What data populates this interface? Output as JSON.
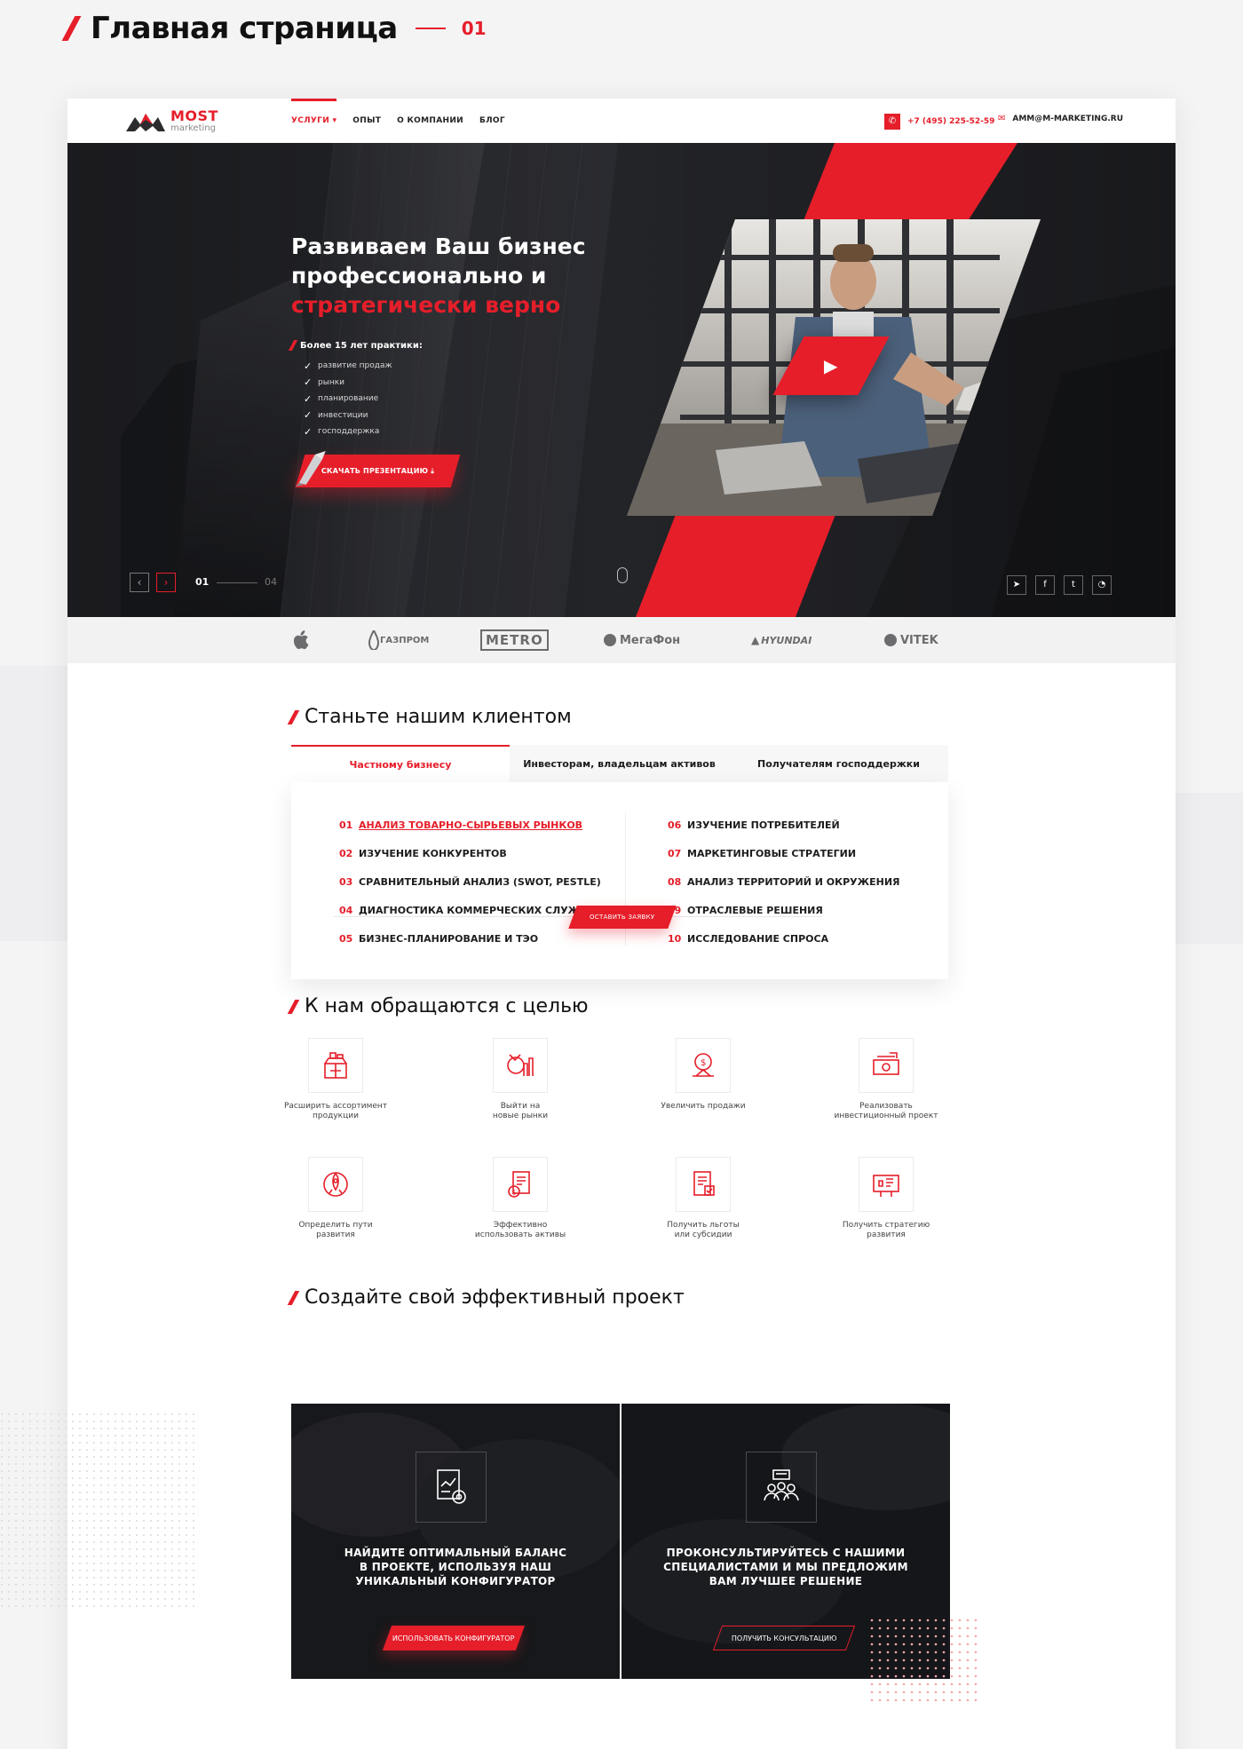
{
  "page": {
    "title": "Главная страница",
    "number": "01"
  },
  "header": {
    "logo": {
      "brand": "MOST",
      "sub": "marketing"
    },
    "nav": [
      {
        "label": "УСЛУГИ ▾",
        "active": true
      },
      {
        "label": "ОПЫТ"
      },
      {
        "label": "О КОМПАНИИ"
      },
      {
        "label": "БЛОГ"
      }
    ],
    "phone": "+7 (495) 225-52-59",
    "email": "AMM@M-MARKETING.RU"
  },
  "hero": {
    "title_line1": "Развиваем Ваш бизнес",
    "title_line2": "профессионально и",
    "title_line3": "стратегически верно",
    "experience": "Более 15 лет практики:",
    "checklist": [
      "развитие продаж",
      "рынки",
      "планирование",
      "инвестиции",
      "господдержка"
    ],
    "download_label": "СКАЧАТЬ ПРЕЗЕНТАЦИЮ ⤓",
    "slide_current": "01",
    "slide_total": "04",
    "social": [
      "telegram-icon",
      "facebook-icon",
      "twitter-icon",
      "whatsapp-icon"
    ]
  },
  "brands": [
    "",
    "ГАЗПРОМ",
    "METRO",
    "МегаФон",
    "HYUNDAI",
    "VITEK"
  ],
  "clients": {
    "title": "Станьте нашим клиентом",
    "tabs": [
      {
        "label": "Частному бизнесу",
        "active": true
      },
      {
        "label": "Инвесторам, владельцам активов"
      },
      {
        "label": "Получателям господдержки"
      }
    ],
    "left": [
      {
        "n": "01",
        "t": "АНАЛИЗ ТОВАРНО-СЫРЬЕВЫХ РЫНКОВ"
      },
      {
        "n": "02",
        "t": "ИЗУЧЕНИЕ КОНКУРЕНТОВ"
      },
      {
        "n": "03",
        "t": "СРАВНИТЕЛЬНЫЙ АНАЛИЗ (SWOT, PESTLE)"
      },
      {
        "n": "04",
        "t": "ДИАГНОСТИКА КОММЕРЧЕСКИХ СЛУЖБ"
      },
      {
        "n": "05",
        "t": "БИЗНЕС-ПЛАНИРОВАНИЕ И ТЭО"
      }
    ],
    "right": [
      {
        "n": "06",
        "t": "ИЗУЧЕНИЕ ПОТРЕБИТЕЛЕЙ"
      },
      {
        "n": "07",
        "t": "МАРКЕТИНГОВЫЕ СТРАТЕГИИ"
      },
      {
        "n": "08",
        "t": "АНАЛИЗ ТЕРРИТОРИЙ И ОКРУЖЕНИЯ"
      },
      {
        "n": "09",
        "t": "ОТРАСЛЕВЫЕ РЕШЕНИЯ"
      },
      {
        "n": "10",
        "t": "ИССЛЕДОВАНИЕ СПРОСА"
      }
    ],
    "request_label": "ОСТАВИТЬ ЗАЯВКУ"
  },
  "goals": {
    "title": "К нам обращаются с целью",
    "items": [
      {
        "l1": "Расширить ассортимент",
        "l2": "продукции",
        "icon": "boxes-icon"
      },
      {
        "l1": "Выйти на",
        "l2": "новые рынки",
        "icon": "market-growth-icon"
      },
      {
        "l1": "Увеличить продажи",
        "l2": "",
        "icon": "money-target-icon"
      },
      {
        "l1": "Реализовать",
        "l2": "инвестиционный проект",
        "icon": "banknote-icon"
      },
      {
        "l1": "Определить пути",
        "l2": "развития",
        "icon": "rocket-icon"
      },
      {
        "l1": "Эффективно",
        "l2": "использовать активы",
        "icon": "assets-document-icon"
      },
      {
        "l1": "Получить льготы",
        "l2": "или субсидии",
        "icon": "subsidy-document-icon"
      },
      {
        "l1": "Получить стратегию",
        "l2": "развития",
        "icon": "strategy-board-icon"
      }
    ]
  },
  "project": {
    "title": "Создайте свой эффективный проект",
    "cards": [
      {
        "l1": "НАЙДИТЕ ОПТИМАЛЬНЫЙ БАЛАНС",
        "l2": "В ПРОЕКТЕ, ИСПОЛЬЗУЯ НАШ",
        "l3": "УНИКАЛЬНЫЙ КОНФИГУРАТОР",
        "button": "ИСПОЛЬЗОВАТЬ КОНФИГУРАТОР"
      },
      {
        "l1": "ПРОКОНСУЛЬТИРУЙТЕСЬ С НАШИМИ",
        "l2": "СПЕЦИАЛИСТАМИ И МЫ ПРЕДЛОЖИМ",
        "l3": "ВАМ ЛУЧШЕЕ РЕШЕНИЕ",
        "button": "ПОЛУЧИТЬ КОНСУЛЬТАЦИЮ"
      }
    ]
  },
  "colors": {
    "accent": "#e61e2a",
    "dark": "#2a2b30"
  }
}
